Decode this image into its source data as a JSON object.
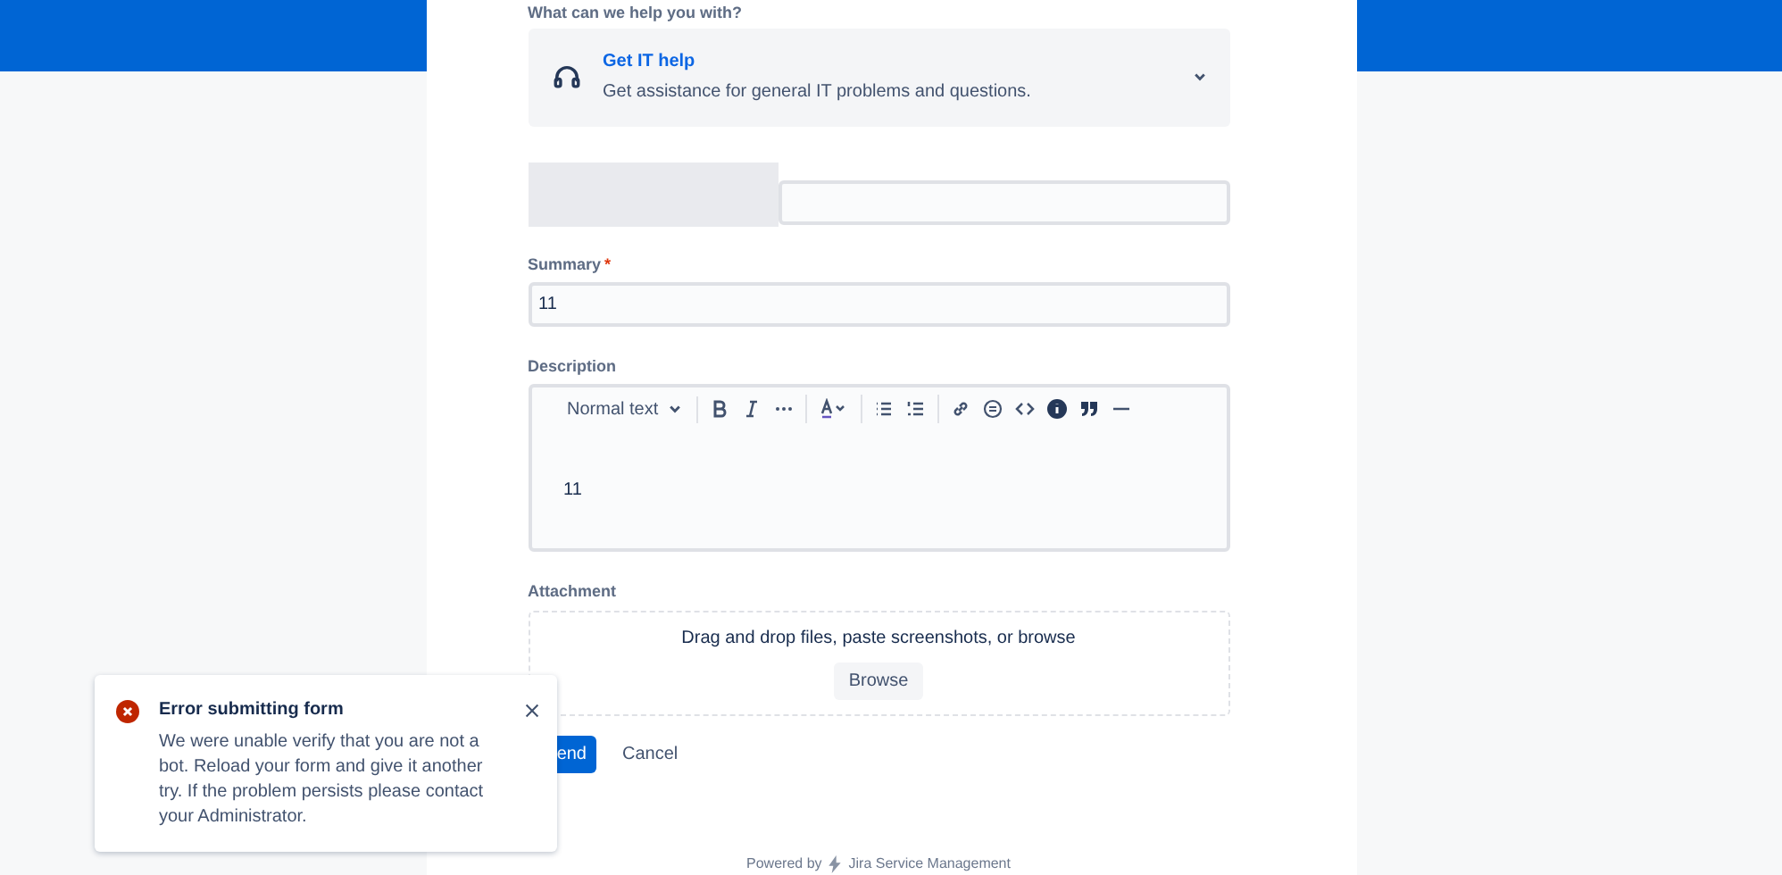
{
  "form": {
    "request_type_label": "What can we help you with?",
    "request_type": {
      "title": "Get IT help",
      "description": "Get assistance for general IT problems and questions."
    },
    "summary": {
      "label": "Summary",
      "required": true,
      "required_marker": "*",
      "value": "11"
    },
    "description": {
      "label": "Description",
      "toolbar": {
        "text_style": "Normal text"
      },
      "value": "11"
    },
    "attachment": {
      "label": "Attachment",
      "hint": "Drag and drop files, paste screenshots, or browse",
      "button": "Browse"
    },
    "buttons": [
      {
        "label": "end",
        "kind": "primary"
      },
      {
        "label": "Cancel",
        "kind": "link"
      }
    ],
    "footer": {
      "prefix": "Powered by",
      "brand": "Jira Service Management"
    }
  },
  "toast": {
    "title": "Error submitting form",
    "message": "We were unable verify that you are not a bot. Reload your form and give it another try. If the problem persists please contact your Administrator."
  }
}
